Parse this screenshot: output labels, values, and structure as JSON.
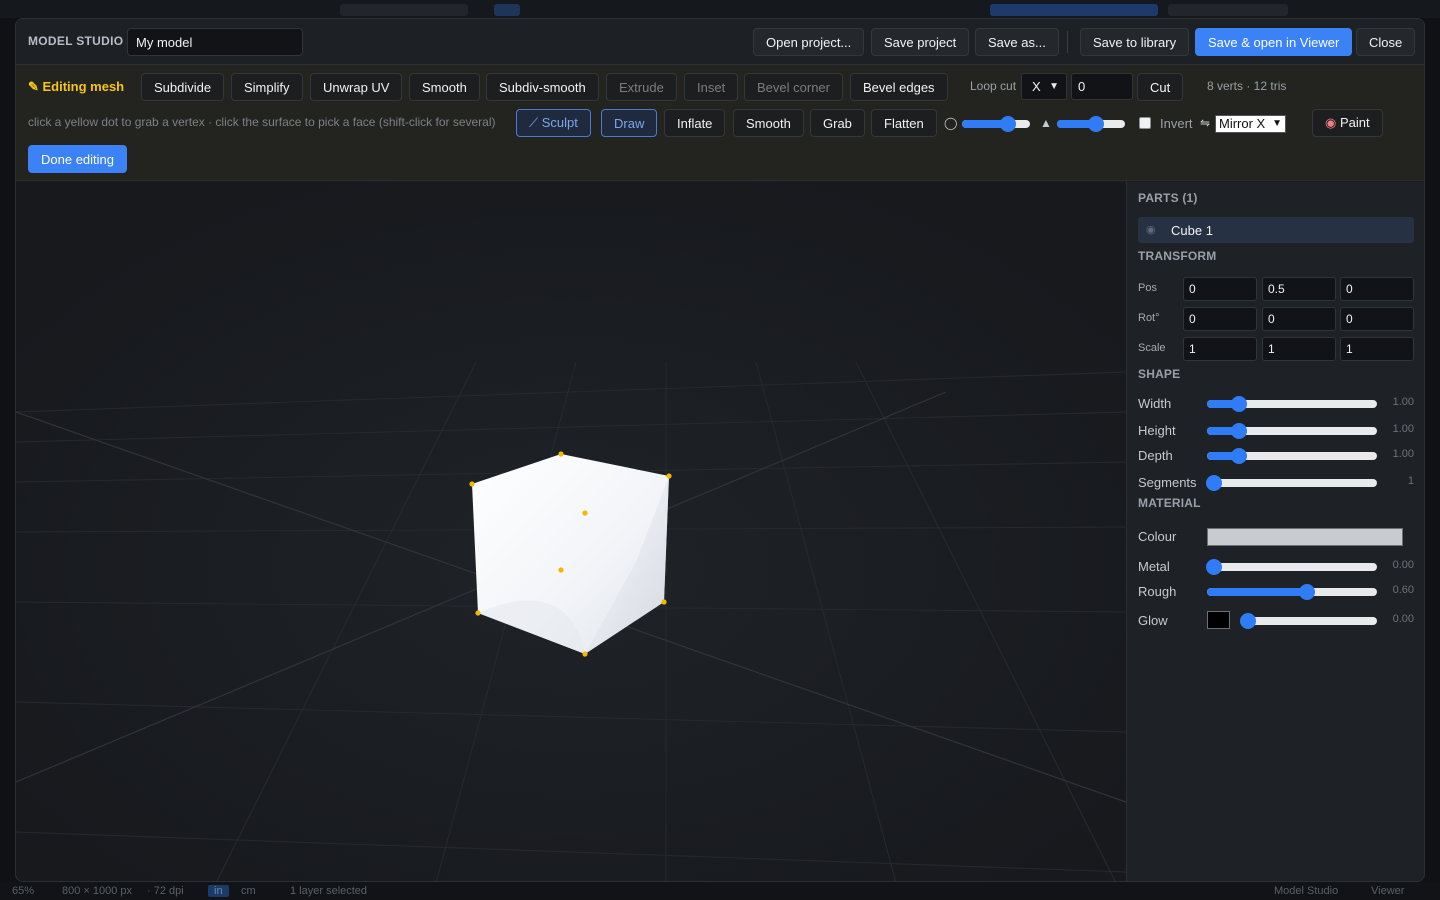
{
  "header": {
    "brand": "MODEL STUDIO",
    "model_name": "My model",
    "buttons": [
      "Open project...",
      "Save project",
      "Save as...",
      "Save to library",
      "Save & open in Viewer",
      "Close"
    ]
  },
  "toolbar": {
    "editing_label": "✎ Editing mesh",
    "mesh_ops": [
      "Subdivide",
      "Simplify",
      "Unwrap UV",
      "Smooth",
      "Subdiv-smooth",
      "Extrude",
      "Inset",
      "Bevel corner",
      "Bevel edges"
    ],
    "loop_cut_label": "Loop cut",
    "loop_axis": "X",
    "loop_value": "0",
    "cut_label": "Cut",
    "stats": "8 verts · 12 tris",
    "hint": "click a yellow dot to grab a vertex · click the surface to pick a face (shift-click for several)",
    "sculpt_tools": [
      "Sculpt",
      "Draw",
      "Inflate",
      "Smooth",
      "Grab",
      "Flatten"
    ],
    "radius_level": 0.68,
    "strength_level": 0.58,
    "invert_label": "Invert",
    "invert_checked": false,
    "mirror_value": "Mirror X",
    "paint_label": "Paint",
    "done_label": "Done editing"
  },
  "panel": {
    "parts_title": "PARTS (1)",
    "part_name": "Cube 1",
    "transform_title": "TRANSFORM",
    "pos_label": "Pos",
    "rot_label": "Rot°",
    "scale_label": "Scale",
    "pos": [
      "0",
      "0.5",
      "0"
    ],
    "rot": [
      "0",
      "0",
      "0"
    ],
    "scale": [
      "1",
      "1",
      "1"
    ],
    "shape_title": "SHAPE",
    "shape": [
      {
        "label": "Width",
        "value": "1.00",
        "level": 0.19
      },
      {
        "label": "Height",
        "value": "1.00",
        "level": 0.19
      },
      {
        "label": "Depth",
        "value": "1.00",
        "level": 0.19
      },
      {
        "label": "Segments",
        "value": "1",
        "level": 0.04
      }
    ],
    "material_title": "MATERIAL",
    "colour_label": "Colour",
    "colour": "#c8ccd1",
    "metal": {
      "label": "Metal",
      "value": "0.00",
      "level": 0.04
    },
    "rough": {
      "label": "Rough",
      "value": "0.60",
      "level": 0.59
    },
    "glow": {
      "label": "Glow",
      "value": "0.00",
      "level": 0.04
    }
  },
  "statusbar": {
    "zoom": "65%",
    "size": "800 × 1000 px",
    "dpi": "· 72 dpi",
    "unit_in": "in",
    "unit_cm": "cm",
    "selection": "1 layer selected",
    "tab_model_studio": "Model Studio",
    "tab_viewer": "Viewer"
  },
  "colors": {
    "accent": "#3b82f6",
    "edit_highlight": "#f5c518",
    "vertex": "#f5b800"
  }
}
